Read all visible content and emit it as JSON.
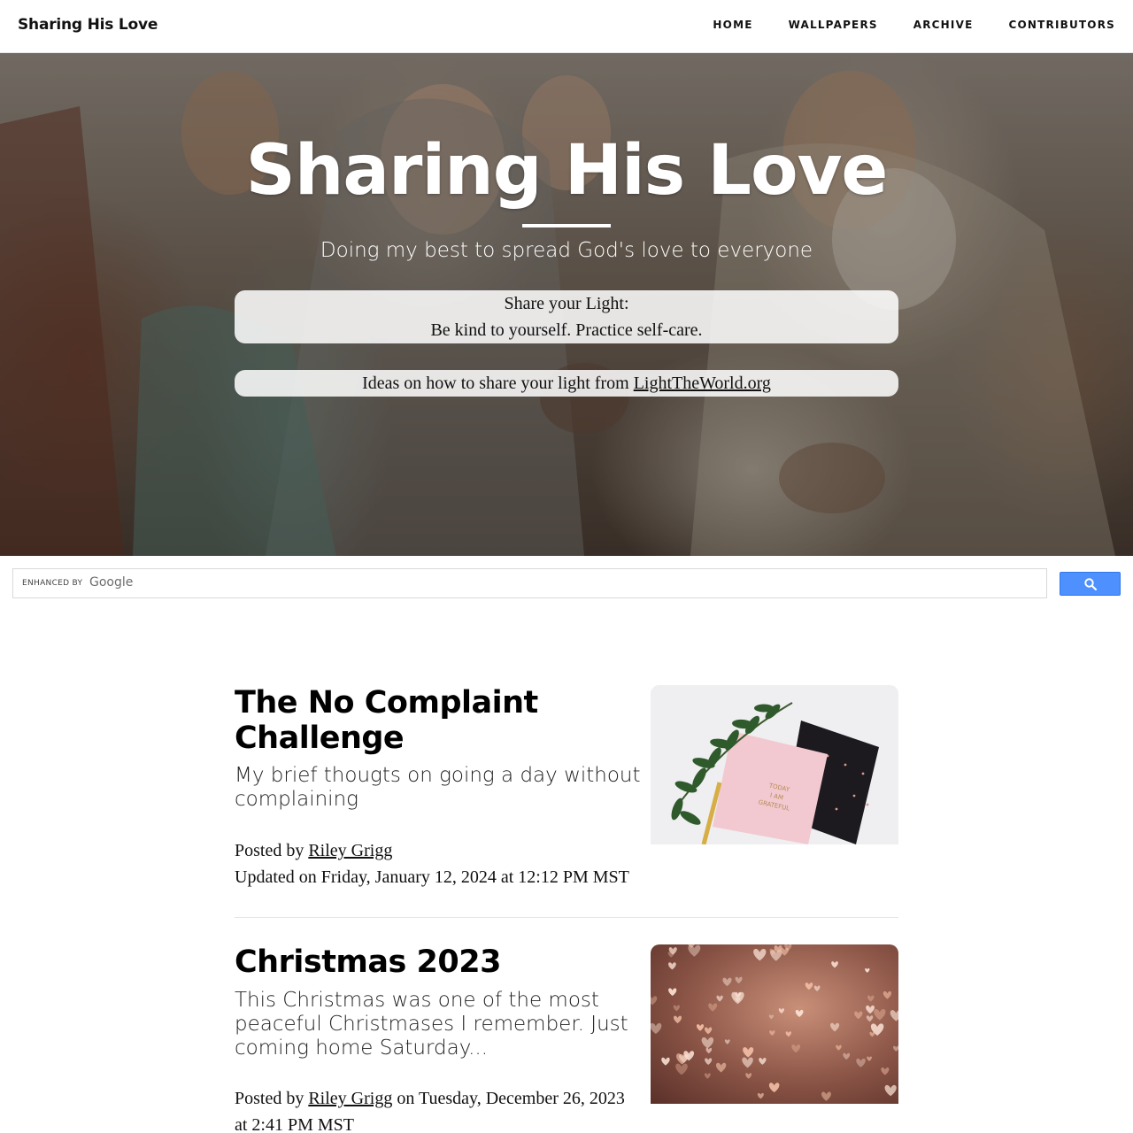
{
  "nav": {
    "brand": "Sharing His Love",
    "links": [
      "HOME",
      "WALLPAPERS",
      "ARCHIVE",
      "CONTRIBUTORS"
    ]
  },
  "hero": {
    "title": "Sharing His Love",
    "subtitle": "Doing my best to spread God's love to everyone",
    "callout1_line1": "Share your Light:",
    "callout1_line2": "Be kind to yourself. Practice self-care.",
    "callout2_text": "Ideas on how to share your light from",
    "callout2_link": "LightTheWorld.org"
  },
  "search": {
    "enhanced_label": "ENHANCED BY",
    "google_label": "Google"
  },
  "posts": [
    {
      "title": "The No Complaint Challenge",
      "subtitle": "My brief thougts on going a day without complaining",
      "posted_by": "Posted by",
      "author": "Riley Grigg",
      "date_text": "Updated on Friday, January 12, 2024 at 12:12 PM MST",
      "thumb_text_1": "TODAY",
      "thumb_text_2": "I AM",
      "thumb_text_3": "GRATEFUL"
    },
    {
      "title": "Christmas 2023",
      "subtitle": "This Christmas was one of the most peaceful Christmases I remember. Just coming home Saturday...",
      "posted_by": "Posted by",
      "author": "Riley Grigg",
      "date_text": "on Tuesday, December 26, 2023 at 2:41 PM MST"
    }
  ],
  "colors": {
    "search_button": "#4d90fe",
    "text": "#111111"
  }
}
